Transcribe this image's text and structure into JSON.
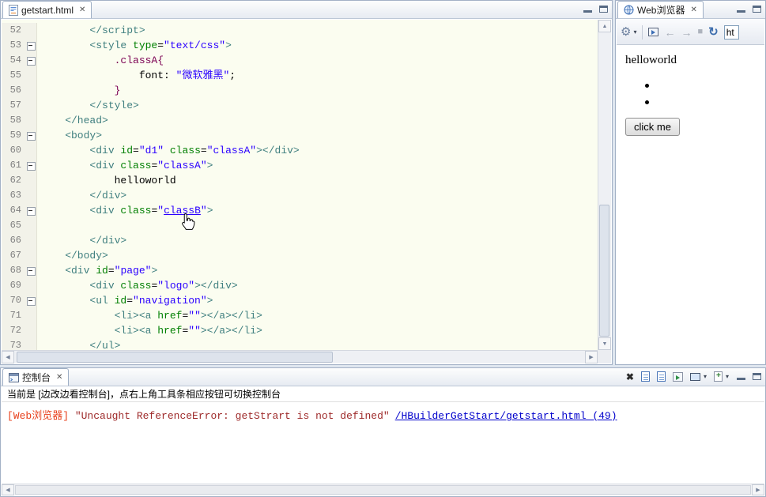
{
  "icons": {
    "up": "▲",
    "down": "▼",
    "left": "◀",
    "right": "▶",
    "gear": "⚙",
    "chevron": "▾",
    "back": "←",
    "forward": "→",
    "stop": "■",
    "refresh": "↻",
    "close": "✕",
    "clear": "✖"
  },
  "editor": {
    "tab_label": "getstart.html",
    "lines": [
      {
        "n": "52",
        "f": false,
        "t": [
          [
            "g",
            "        </script>"
          ]
        ]
      },
      {
        "n": "53",
        "f": true,
        "t": [
          [
            "g",
            "        <style"
          ],
          [
            "a",
            " type"
          ],
          [
            "p",
            "="
          ],
          [
            "v",
            "\"text/css\""
          ],
          [
            "g",
            ">"
          ]
        ]
      },
      {
        "n": "54",
        "f": true,
        "t": [
          [
            "s",
            "            .classA{"
          ]
        ]
      },
      {
        "n": "55",
        "f": false,
        "t": [
          [
            "p",
            "                font: "
          ],
          [
            "v",
            "\"微软雅黑\""
          ],
          [
            "p",
            ";"
          ]
        ]
      },
      {
        "n": "56",
        "f": false,
        "t": [
          [
            "s",
            "            }"
          ]
        ]
      },
      {
        "n": "57",
        "f": false,
        "t": [
          [
            "g",
            "        </style>"
          ]
        ]
      },
      {
        "n": "58",
        "f": false,
        "t": [
          [
            "g",
            "    </head>"
          ]
        ]
      },
      {
        "n": "59",
        "f": true,
        "t": [
          [
            "g",
            "    <body>"
          ]
        ]
      },
      {
        "n": "60",
        "f": false,
        "t": [
          [
            "g",
            "        <div"
          ],
          [
            "a",
            " id"
          ],
          [
            "p",
            "="
          ],
          [
            "v",
            "\"d1\""
          ],
          [
            "a",
            " class"
          ],
          [
            "p",
            "="
          ],
          [
            "v",
            "\"classA\""
          ],
          [
            "g",
            "></div>"
          ]
        ]
      },
      {
        "n": "61",
        "f": true,
        "t": [
          [
            "g",
            "        <div"
          ],
          [
            "a",
            " class"
          ],
          [
            "p",
            "="
          ],
          [
            "v",
            "\"classA\""
          ],
          [
            "g",
            ">"
          ]
        ]
      },
      {
        "n": "62",
        "f": false,
        "t": [
          [
            "p",
            "            helloworld"
          ]
        ]
      },
      {
        "n": "63",
        "f": false,
        "t": [
          [
            "g",
            "        </div>"
          ]
        ]
      },
      {
        "n": "64",
        "f": true,
        "t": [
          [
            "g",
            "        <div"
          ],
          [
            "a",
            " class"
          ],
          [
            "p",
            "="
          ],
          [
            "v",
            "\""
          ],
          [
            "l",
            "classB"
          ],
          [
            "v",
            "\""
          ],
          [
            "g",
            ">"
          ]
        ]
      },
      {
        "n": "65",
        "f": false,
        "t": []
      },
      {
        "n": "66",
        "f": false,
        "t": [
          [
            "g",
            "        </div>"
          ]
        ]
      },
      {
        "n": "67",
        "f": false,
        "t": [
          [
            "g",
            "    </body>"
          ]
        ]
      },
      {
        "n": "68",
        "f": true,
        "t": [
          [
            "g",
            "    <div"
          ],
          [
            "a",
            " id"
          ],
          [
            "p",
            "="
          ],
          [
            "v",
            "\"page\""
          ],
          [
            "g",
            ">"
          ]
        ]
      },
      {
        "n": "69",
        "f": false,
        "t": [
          [
            "g",
            "        <div"
          ],
          [
            "a",
            " class"
          ],
          [
            "p",
            "="
          ],
          [
            "v",
            "\"logo\""
          ],
          [
            "g",
            "></div>"
          ]
        ]
      },
      {
        "n": "70",
        "f": true,
        "t": [
          [
            "g",
            "        <ul"
          ],
          [
            "a",
            " id"
          ],
          [
            "p",
            "="
          ],
          [
            "v",
            "\"navigation\""
          ],
          [
            "g",
            ">"
          ]
        ]
      },
      {
        "n": "71",
        "f": false,
        "t": [
          [
            "g",
            "            <li><a"
          ],
          [
            "a",
            " href"
          ],
          [
            "p",
            "="
          ],
          [
            "v",
            "\"\""
          ],
          [
            "g",
            "></a></li>"
          ]
        ]
      },
      {
        "n": "72",
        "f": false,
        "t": [
          [
            "g",
            "            <li><a"
          ],
          [
            "a",
            " href"
          ],
          [
            "p",
            "="
          ],
          [
            "v",
            "\"\""
          ],
          [
            "g",
            "></a></li>"
          ]
        ]
      },
      {
        "n": "73",
        "f": false,
        "t": [
          [
            "g",
            "        </ul>"
          ]
        ]
      }
    ]
  },
  "browser": {
    "tab_label": "Web浏览器",
    "url_value": "ht",
    "content_text": "helloworld",
    "button_label": "click me"
  },
  "console": {
    "tab_label": "控制台",
    "info_text": "当前是 [边改边看控制台]，点右上角工具条相应按钮可切换控制台",
    "error_prefix": "[Web浏览器]",
    "error_message": " \"Uncaught ReferenceError: getStrart is not defined\"",
    "error_link": "/HBuilderGetStart/getstart.html (49)"
  }
}
